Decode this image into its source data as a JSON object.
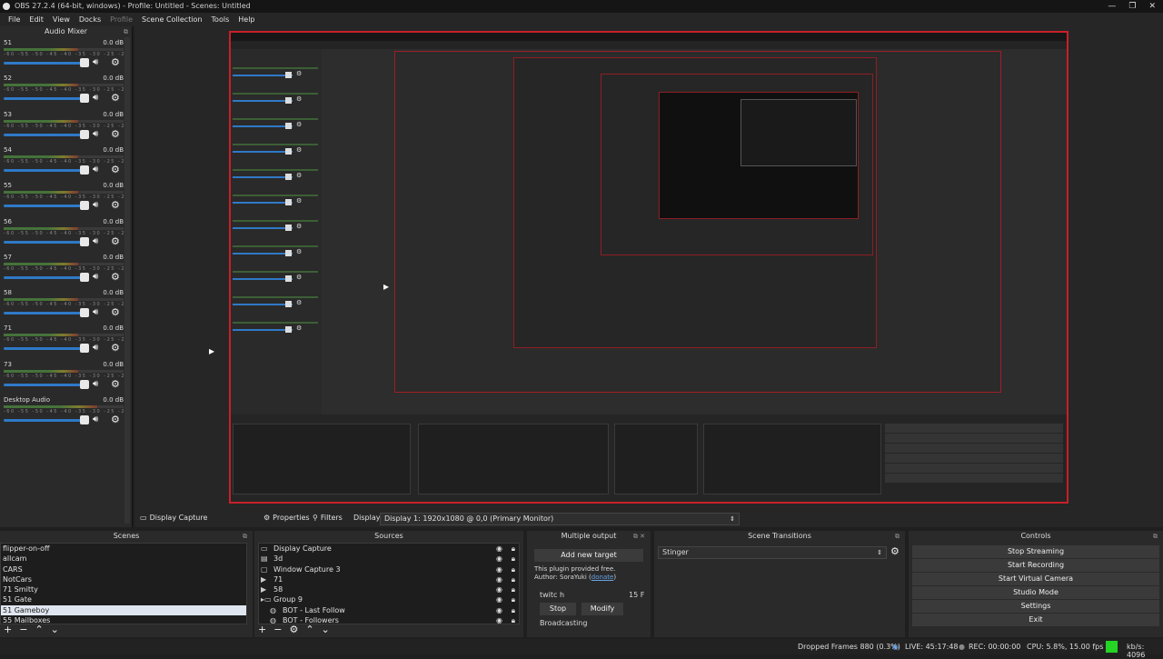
{
  "window": {
    "title": "OBS 27.2.4 (64-bit, windows) - Profile: Untitled - Scenes: Untitled",
    "controls": [
      "—",
      "❐",
      "✕"
    ]
  },
  "menu": [
    "File",
    "Edit",
    "View",
    "Docks",
    "Profile",
    "Scene Collection",
    "Tools",
    "Help"
  ],
  "mixer": {
    "title": "Audio Mixer",
    "channels": [
      {
        "name": "51",
        "db": "0.0 dB"
      },
      {
        "name": "52",
        "db": "0.0 dB"
      },
      {
        "name": "53",
        "db": "0.0 dB"
      },
      {
        "name": "54",
        "db": "0.0 dB"
      },
      {
        "name": "55",
        "db": "0.0 dB"
      },
      {
        "name": "56",
        "db": "0.0 dB"
      },
      {
        "name": "57",
        "db": "0.0 dB"
      },
      {
        "name": "58",
        "db": "0.0 dB"
      },
      {
        "name": "71",
        "db": "0.0 dB"
      },
      {
        "name": "73",
        "db": "0.0 dB"
      },
      {
        "name": "Desktop Audio",
        "db": "0.0 dB"
      }
    ],
    "scale": "-60 -55 -50 -45 -40 -35 -30 -25 -20 -15 -10 -5 0"
  },
  "toolbar": {
    "source": "Display Capture",
    "properties": "Properties",
    "filters": "Filters",
    "display_label": "Display",
    "display_value": "Display 1: 1920x1080 @ 0,0 (Primary Monitor)"
  },
  "scenes": {
    "title": "Scenes",
    "items": [
      "flipper-on-off",
      "allcam",
      "CARS",
      "NotCars",
      "71 Smitty",
      "51 Gate",
      "51 Gameboy",
      "55 Mailboxes"
    ],
    "selected_index": 6
  },
  "sources": {
    "title": "Sources",
    "items": [
      {
        "label": "Display Capture",
        "icon": "monitor-icon"
      },
      {
        "label": "3d",
        "icon": "folder-icon"
      },
      {
        "label": "Window Capture 3",
        "icon": "window-icon"
      },
      {
        "label": "71",
        "icon": "play-icon"
      },
      {
        "label": "58",
        "icon": "play-icon"
      },
      {
        "label": "Group 9",
        "icon": "group-icon"
      },
      {
        "label": "BOT - Last Follow",
        "icon": "browser-icon"
      },
      {
        "label": "BOT - Followers",
        "icon": "browser-icon"
      }
    ]
  },
  "multiple_output": {
    "title": "Multiple output",
    "add_target": "Add new target",
    "info_line1": "This plugin provided free.",
    "info_line2_prefix": "Author: SoraYuki (",
    "donate": "donate",
    "info_line2_suffix": ")",
    "target_name": "twitc h",
    "target_flag": "15 F",
    "stop": "Stop",
    "modify": "Modify",
    "status": "Broadcasting"
  },
  "transitions": {
    "title": "Scene Transitions",
    "selected": "Stinger"
  },
  "controls": {
    "title": "Controls",
    "buttons": [
      "Stop Streaming",
      "Start Recording",
      "Start Virtual Camera",
      "Studio Mode",
      "Settings",
      "Exit"
    ]
  },
  "status": {
    "dropped": "Dropped Frames 880 (0.3%)",
    "live": "LIVE: 45:17:48",
    "rec": "REC: 00:00:00",
    "cpu": "CPU: 5.8%, 15.00 fps",
    "kbps": "kb/s: 4096",
    "indicator_color": "#25d425"
  },
  "colors": {
    "accent_red": "#c81f2a",
    "slider_blue": "#2f79c7"
  }
}
